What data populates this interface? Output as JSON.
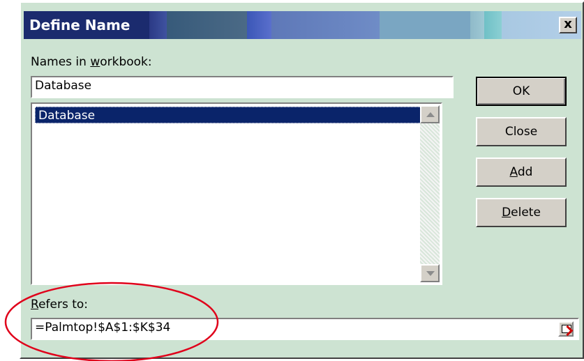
{
  "dialog": {
    "title": "Define Name",
    "close_glyph": "x"
  },
  "names": {
    "label_pre": "Names in ",
    "label_accel": "w",
    "label_post": "orkbook:",
    "input_value": "Database",
    "items": [
      "Database"
    ],
    "selected_item": "Database"
  },
  "buttons": {
    "ok": "OK",
    "close": "Close",
    "add_accel": "A",
    "add_rest": "dd",
    "delete_accel": "D",
    "delete_rest": "elete"
  },
  "refers": {
    "label_accel": "R",
    "label_rest": "efers to:",
    "value": "=Palmtop!$A$1:$K$34"
  },
  "icons": {
    "close": "close-icon",
    "scroll_up": "scroll-up-arrow-icon",
    "scroll_down": "scroll-down-arrow-icon",
    "collapse": "collapse-dialog-icon"
  },
  "colors": {
    "dialog_bg": "#cde3d2",
    "selection": "#0a246a",
    "annotation": "#e0001a"
  }
}
